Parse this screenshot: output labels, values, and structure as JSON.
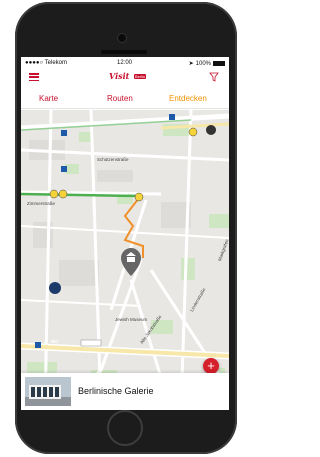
{
  "statusbar": {
    "carrier": "●●●●○ Telekom",
    "time": "12:00",
    "battery": "100%"
  },
  "header": {
    "logo_text": "Visit",
    "logo_tag": "Berlin",
    "menu_icon": "hamburger-menu-icon",
    "filter_icon": "filter-funnel-icon"
  },
  "tabs": [
    {
      "label": "Karte"
    },
    {
      "label": "Routen"
    },
    {
      "label": "Entdecken"
    }
  ],
  "map": {
    "labels": {
      "schuetzenstrasse": "Schützenstraße",
      "zimmerstrasse": "Zimmerstraße",
      "jewish_museum": "Jewish Museum",
      "wc": "WC",
      "l1066": "L 1066",
      "lindenstrasse": "Lindenstraße",
      "alte_jakobstrasse": "Alte Jakobstraße",
      "markgrafen": "Markgrafen"
    }
  },
  "colors": {
    "brand_red": "#c8102e",
    "entdecken_orange": "#f39200",
    "route_orange": "#f0902a",
    "green_route": "#4caf50",
    "fab_red": "#d51f2b"
  },
  "fab": {
    "label": "+"
  },
  "card": {
    "title": "Berlinische Galerie"
  }
}
